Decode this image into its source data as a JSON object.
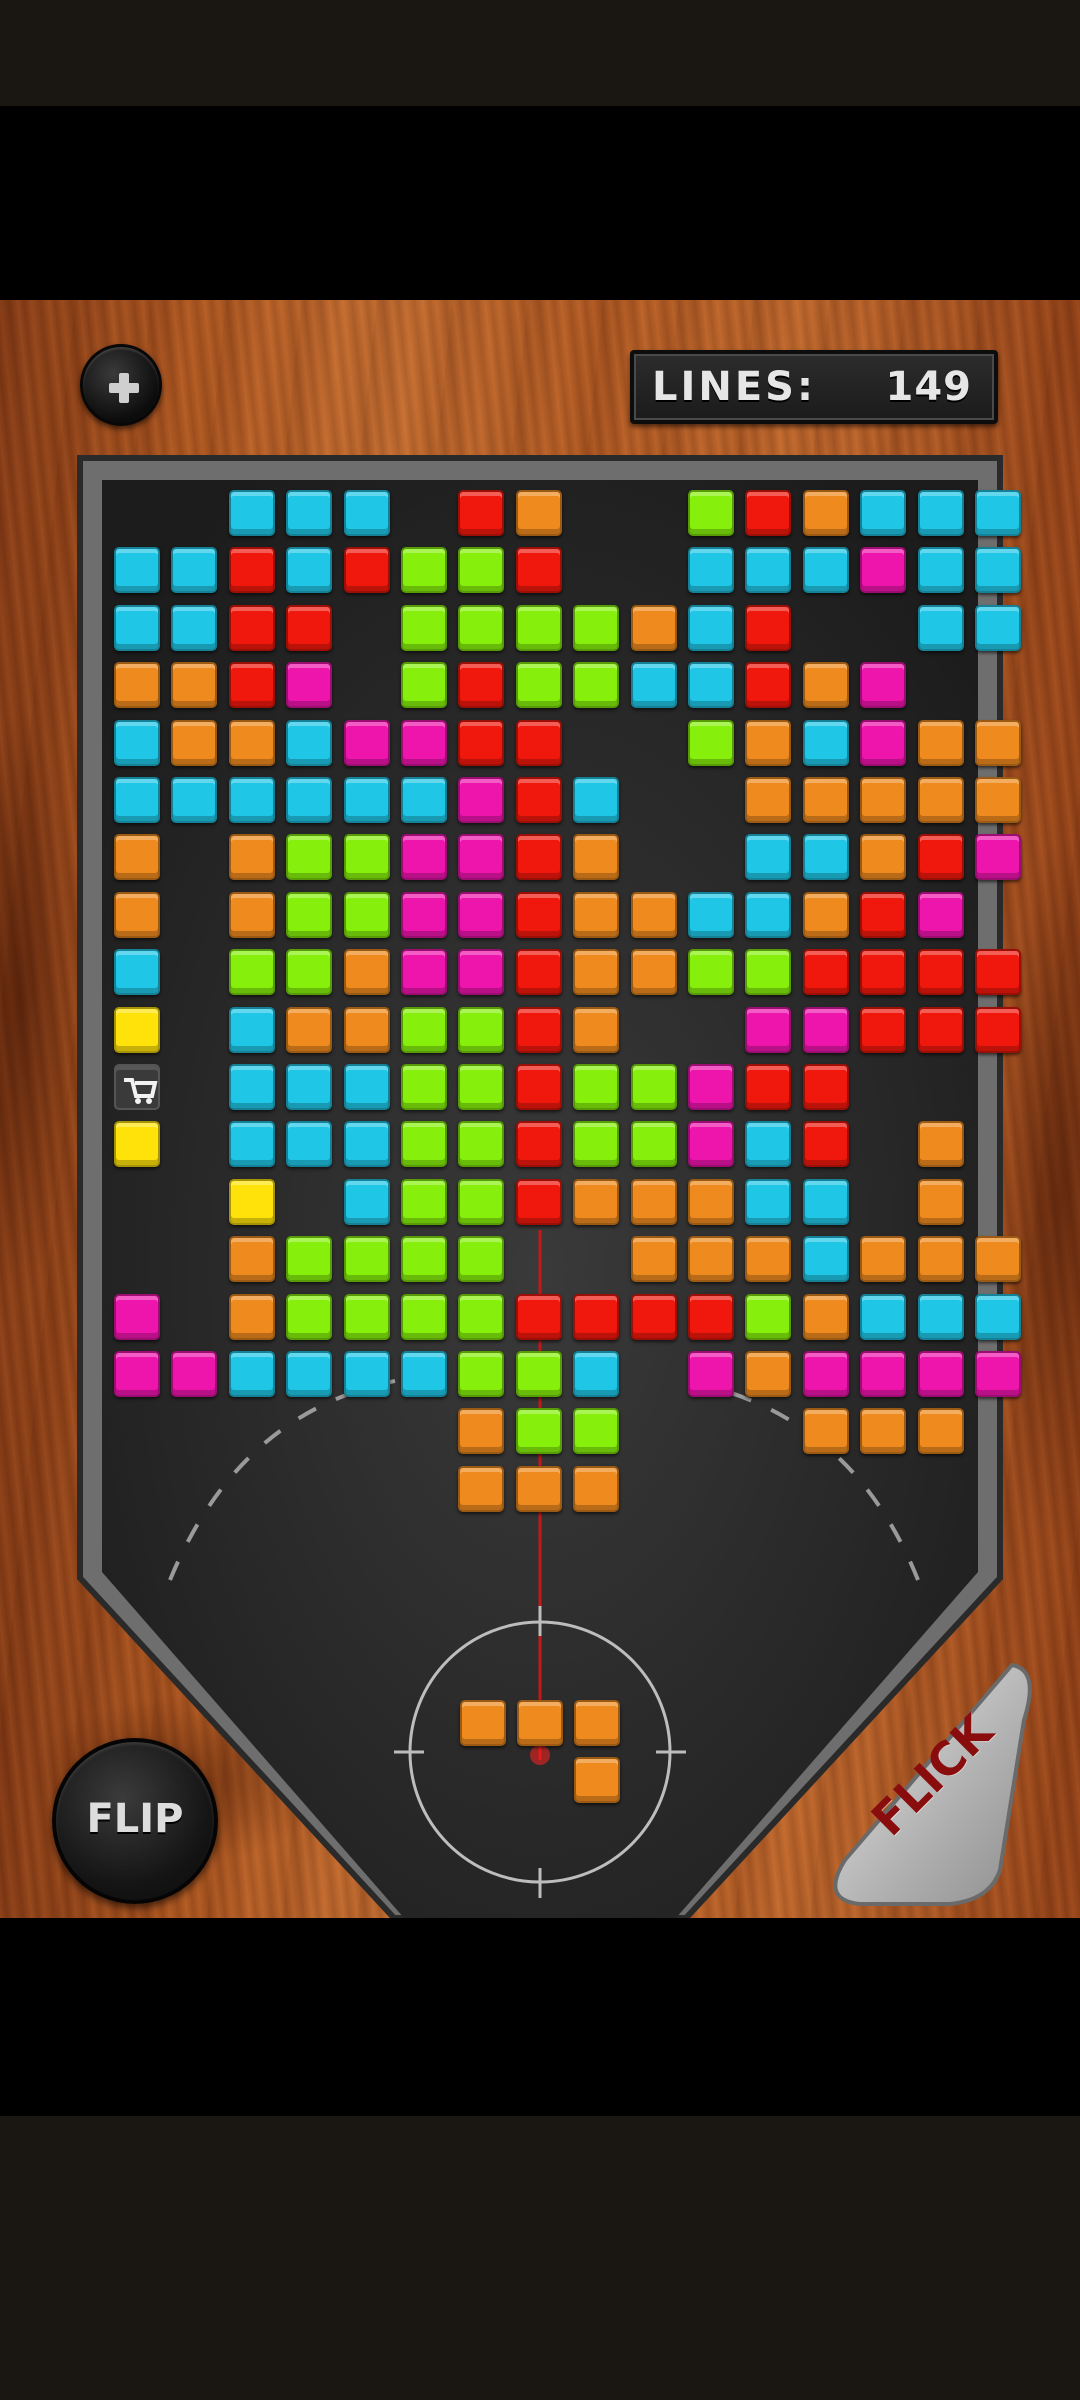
{
  "hud": {
    "lines_label": "LINES:",
    "lines_value": "149",
    "add_icon": "plus-icon"
  },
  "controls": {
    "flip_label": "FLIP",
    "flick_label": "FLICK"
  },
  "colors": {
    "C": "#1fc6e6",
    "R": "#f0180c",
    "O": "#ee8a1e",
    "G": "#86f00c",
    "M": "#ee15ad",
    "Y": "#ffe20a"
  },
  "board": {
    "rows": [
      "..CCC.RO..GROCCC",
      "CCRCRGGR..CCCMCC",
      "CCRR.GGGGOCR..CC",
      "OORM.GRGGCCROM..",
      "COOCMMRR..GOCMOO",
      "CCCCCCMRC..OOOOO",
      "O.OGGMMRO..CCORM",
      "O.OGGMMROOCCORM.",
      "C.GGOMMROOGGRRRR",
      "Y.COOGGRO..MMRRR",
      "T.CCCGGRGGMRR...",
      "Y.CCCGGRGGMCR.O.",
      "..Y.CGGROOOCC.O.",
      "..OGGGG..OOOCOOO",
      "M.OGGGGRRRRGOCCC",
      "MMCCCCGGC.MOMMMM",
      "......OGG...OOO.",
      "......OOO......."
    ],
    "trap_icon": "cart-icon"
  },
  "next_piece": {
    "cells": [
      [
        -1,
        0
      ],
      [
        0,
        0
      ],
      [
        1,
        0
      ],
      [
        1,
        1
      ]
    ],
    "color_key": "O"
  }
}
